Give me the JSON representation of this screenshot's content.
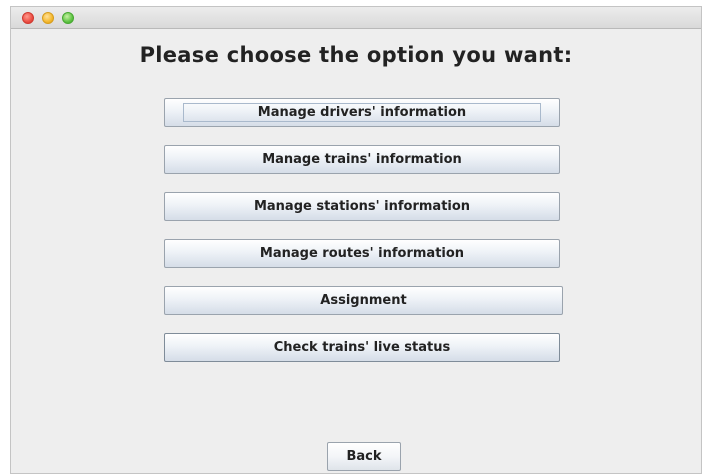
{
  "window": {
    "controls": {
      "close_icon": "close-icon",
      "minimize_icon": "minimize-icon",
      "zoom_icon": "zoom-icon",
      "close_color": "#ec4f44",
      "minimize_color": "#f4b82e",
      "zoom_color": "#5fc444"
    }
  },
  "main": {
    "heading": "Please choose the option you want:",
    "options": [
      {
        "label": "Manage drivers' information"
      },
      {
        "label": "Manage trains' information"
      },
      {
        "label": "Manage stations' information"
      },
      {
        "label": "Manage routes' information"
      },
      {
        "label": "Assignment"
      },
      {
        "label": "Check trains' live status"
      }
    ],
    "back_label": "Back"
  }
}
